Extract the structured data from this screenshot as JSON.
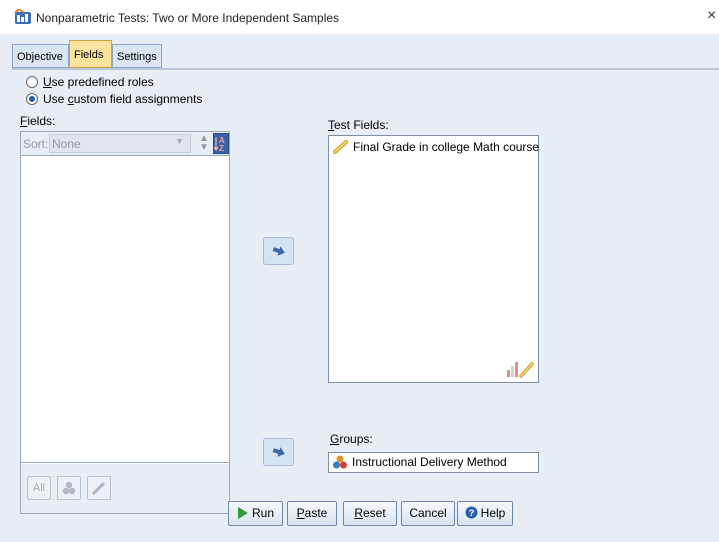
{
  "window": {
    "title": "Nonparametric Tests: Two or More Independent Samples",
    "close": "×"
  },
  "tabs": [
    {
      "label": "Objective",
      "active": false
    },
    {
      "label": "Fields",
      "active": true
    },
    {
      "label": "Settings",
      "active": false
    }
  ],
  "roles": {
    "predefined": {
      "prefix": "",
      "mnemonic": "U",
      "rest": "se predefined roles",
      "selected": false
    },
    "custom": {
      "prefix": "Use ",
      "mnemonic": "c",
      "rest": "ustom field assignments",
      "selected": true
    }
  },
  "fields_panel": {
    "label_mnemonic": "F",
    "label_rest": "ields:",
    "sort_label": "Sort:",
    "sort_value": "None",
    "footer_buttons": [
      "All",
      "nominal-icon",
      "scale-icon"
    ]
  },
  "test_fields": {
    "label_mnemonic": "T",
    "label_rest": "est Fields:",
    "items": [
      {
        "label": "Final Grade in college Math course",
        "icon": "scale-ruler-icon"
      }
    ]
  },
  "groups": {
    "label_mnemonic": "G",
    "label_rest": "roups:",
    "value": "Instructional Delivery Method",
    "icon": "nominal-icon"
  },
  "buttons": {
    "run": "Run",
    "paste_m": "P",
    "paste_r": "aste",
    "reset_m": "R",
    "reset_r": "eset",
    "cancel": "Cancel",
    "help": "Help"
  },
  "colors": {
    "dialog_bg": "#e8eef6",
    "active_tab": "#fbe39b",
    "accent_blue": "#2b5fab"
  }
}
